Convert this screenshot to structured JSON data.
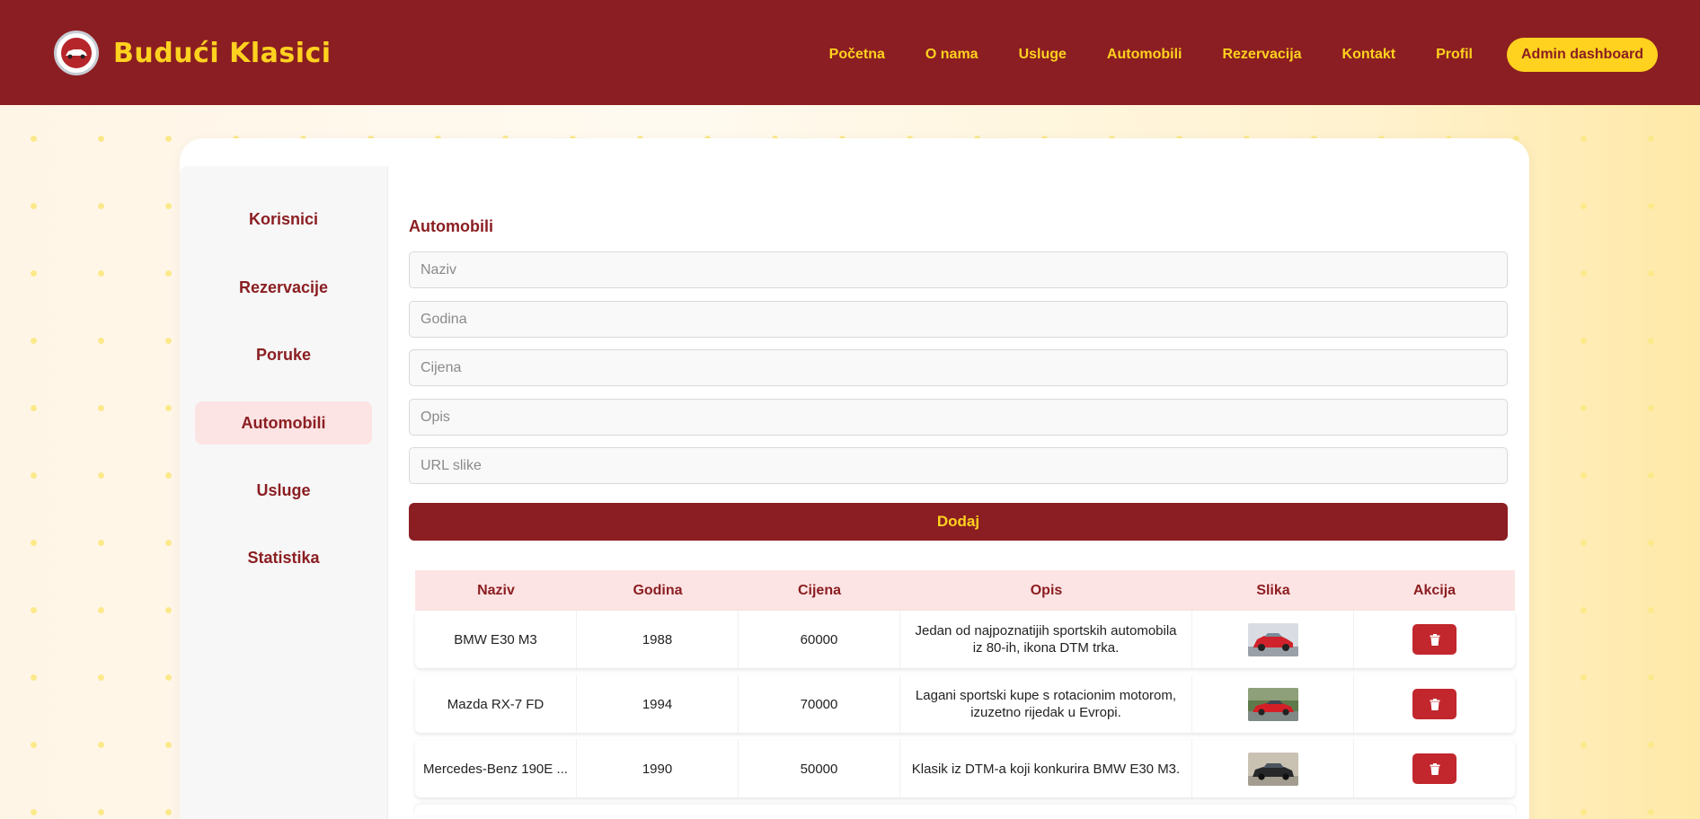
{
  "brand": {
    "name": "Budući Klasici",
    "logo": "logo-badge"
  },
  "nav": {
    "links": [
      "Početna",
      "O nama",
      "Usluge",
      "Automobili",
      "Rezervacija",
      "Kontakt",
      "Profil"
    ],
    "admin_button": "Admin dashboard"
  },
  "sidebar": {
    "items": [
      "Korisnici",
      "Rezervacije",
      "Poruke",
      "Automobili",
      "Usluge",
      "Statistika"
    ],
    "active": "Automobili"
  },
  "form": {
    "title": "Automobili",
    "placeholders": {
      "naziv": "Naziv",
      "godina": "Godina",
      "cijena": "Cijena",
      "opis": "Opis",
      "url": "URL slike"
    },
    "submit_label": "Dodaj"
  },
  "table": {
    "headers": [
      "Naziv",
      "Godina",
      "Cijena",
      "Opis",
      "Slika",
      "Akcija"
    ],
    "rows": [
      {
        "naziv": "BMW E30 M3",
        "godina": "1988",
        "cijena": "60000",
        "opis": "Jedan od najpoznatijih sportskih automobila iz 80-ih, ikona DTM trka.",
        "image": "red-bmw-thumbnail",
        "action_icon": "trash-icon"
      },
      {
        "naziv": "Mazda RX-7 FD",
        "godina": "1994",
        "cijena": "70000",
        "opis": "Lagani sportski kupe s rotacionim motorom, izuzetno rijedak u Evropi.",
        "image": "red-mazda-thumbnail",
        "action_icon": "trash-icon"
      },
      {
        "naziv": "Mercedes-Benz 190E ...",
        "godina": "1990",
        "cijena": "50000",
        "opis": "Klasik iz DTM-a koji konkurira BMW E30 M3.",
        "image": "black-mercedes-thumbnail",
        "action_icon": "trash-icon"
      }
    ]
  },
  "colors": {
    "primary": "#8b1e22",
    "accent": "#ffd21f",
    "active_bg": "#fde4e4",
    "danger": "#c1272d"
  }
}
